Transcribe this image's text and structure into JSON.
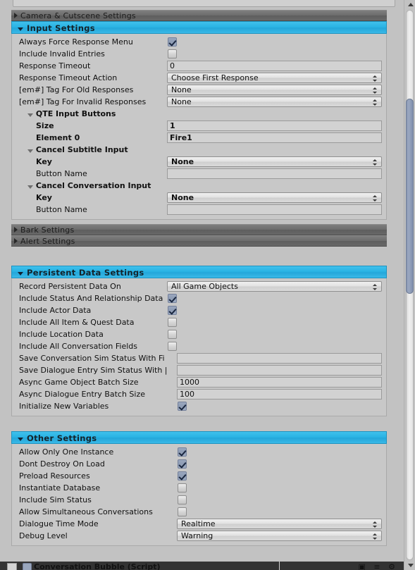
{
  "window": {
    "scrollbar": {
      "up_arrow": "scroll-up",
      "down_arrow": "scroll-down"
    }
  },
  "sections": {
    "camera_cutscene": {
      "title": "Camera & Cutscene Settings",
      "expanded": false
    },
    "input_settings": {
      "title": "Input Settings",
      "expanded": true,
      "rows": [
        {
          "label": "Always Force Response Menu",
          "type": "checkbox",
          "value": true
        },
        {
          "label": "Include Invalid Entries",
          "type": "checkbox",
          "value": false
        },
        {
          "label": "Response Timeout",
          "type": "input",
          "value": "0"
        },
        {
          "label": "Response Timeout Action",
          "type": "popup",
          "value": "Choose First Response"
        },
        {
          "label": "[em#] Tag For Old Responses",
          "type": "popup",
          "value": "None"
        },
        {
          "label": "[em#] Tag For Invalid Responses",
          "type": "popup",
          "value": "None"
        }
      ],
      "qte": {
        "title": "QTE Input Buttons",
        "size_label": "Size",
        "size_value": "1",
        "element_label": "Element 0",
        "element_value": "Fire1"
      },
      "cancel_subtitle": {
        "title": "Cancel Subtitle Input",
        "key_label": "Key",
        "key_value": "None",
        "button_name_label": "Button Name",
        "button_name_value": ""
      },
      "cancel_conversation": {
        "title": "Cancel Conversation Input",
        "key_label": "Key",
        "key_value": "None",
        "button_name_label": "Button Name",
        "button_name_value": ""
      }
    },
    "bark_settings": {
      "title": "Bark Settings",
      "expanded": false
    },
    "alert_settings": {
      "title": "Alert Settings",
      "expanded": false
    },
    "persistent_data": {
      "title": "Persistent Data Settings",
      "expanded": true,
      "rows": [
        {
          "label": "Record Persistent Data On",
          "type": "popup",
          "value": "All Game Objects"
        },
        {
          "label": "Include Status And Relationship Data",
          "type": "checkbox",
          "value": true
        },
        {
          "label": "Include Actor Data",
          "type": "checkbox",
          "value": true
        },
        {
          "label": "Include All Item & Quest Data",
          "type": "checkbox",
          "value": false
        },
        {
          "label": "Include Location Data",
          "type": "checkbox",
          "value": false
        },
        {
          "label": "Include All Conversation Fields",
          "type": "checkbox",
          "value": false
        },
        {
          "label": "Save Conversation Sim Status With Fi",
          "type": "input",
          "value": ""
        },
        {
          "label": "Save Dialogue Entry Sim Status With |",
          "type": "input",
          "value": ""
        },
        {
          "label": "Async Game Object Batch Size",
          "type": "input",
          "value": "1000"
        },
        {
          "label": "Async Dialogue Entry Batch Size",
          "type": "input",
          "value": "100"
        },
        {
          "label": "Initialize New Variables",
          "type": "checkbox",
          "value": true
        }
      ]
    },
    "other_settings": {
      "title": "Other Settings",
      "expanded": true,
      "rows": [
        {
          "label": "Allow Only One Instance",
          "type": "checkbox",
          "value": true
        },
        {
          "label": "Dont Destroy On Load",
          "type": "checkbox",
          "value": true
        },
        {
          "label": "Preload Resources",
          "type": "checkbox",
          "value": true
        },
        {
          "label": "Instantiate Database",
          "type": "checkbox",
          "value": false
        },
        {
          "label": "Include Sim Status",
          "type": "checkbox",
          "value": false
        },
        {
          "label": "Allow Simultaneous Conversations",
          "type": "checkbox",
          "value": false
        },
        {
          "label": "Dialogue Time Mode",
          "type": "popup",
          "value": "Realtime"
        },
        {
          "label": "Debug Level",
          "type": "popup",
          "value": "Warning"
        }
      ]
    }
  },
  "bottom_strip": {
    "label": "Conversation Bubble (Script)",
    "icons": "▣ ≡ ⚙"
  },
  "colors": {
    "accent_cyan": "#2ab4e4",
    "panel_bg": "#c8c8c8",
    "window_bg": "#c2c2c2",
    "header_dark": "#6d6d6d",
    "checkbox_on": "#9aa7be"
  }
}
